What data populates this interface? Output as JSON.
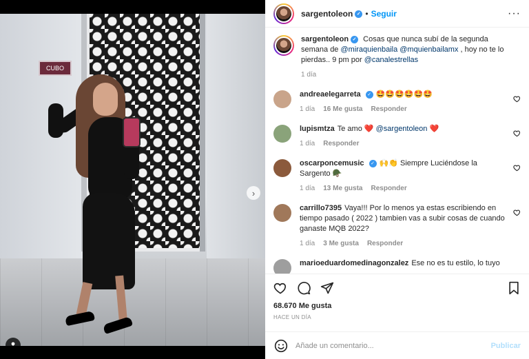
{
  "post": {
    "author": "sargentoleon",
    "follow_label": "Seguir",
    "caption_prefix": "Cosas que nunca subí de la segunda semana de ",
    "caption_mention1": "@miraquienbaila",
    "caption_mention2": "@mquienbailamx",
    "caption_middle": " , hoy no te lo pierdas.. 9 pm por ",
    "caption_mention3": "@canalestrellas",
    "caption_time": "1 día",
    "door_sign_text": "CUBO",
    "likes": "68.670 Me gusta",
    "date": "HACE UN DÍA",
    "carousel_dots": 5,
    "carousel_active_index": 0
  },
  "comments": [
    {
      "user": "andreaelegarreta",
      "verified": true,
      "text": "🤩🤩🤩🤩🤩🤩",
      "time": "1 día",
      "likes": "16 Me gusta",
      "reply": "Responder",
      "avatar_color": "#c9a48a"
    },
    {
      "user": "lupismtza",
      "verified": false,
      "text": "Te amo ❤️ ",
      "mention": "@sargentoleon",
      "text_after": " ❤️",
      "time": "1 día",
      "likes": "",
      "reply": "Responder",
      "avatar_color": "#8aa37a"
    },
    {
      "user": "oscarponcemusic",
      "verified": true,
      "text": "🙌👏 Siempre Luciéndose la Sargento 🪖",
      "time": "1 día",
      "likes": "13 Me gusta",
      "reply": "Responder",
      "avatar_color": "#8b5a3c"
    },
    {
      "user": "carrillo7395",
      "verified": false,
      "text": "Vaya!!! Por lo menos ya estas escribiendo en tiempo pasado ( 2022 ) tambien vas a subir cosas de cuando ganaste MQB 2022?",
      "time": "1 día",
      "likes": "3 Me gusta",
      "reply": "Responder",
      "avatar_color": "#a0785a"
    },
    {
      "user": "marioeduardomedinagonzalez",
      "verified": false,
      "text": "Ese no es tu estilo, lo tuyo",
      "time": "",
      "likes": "",
      "reply": "",
      "avatar_color": "#9e9e9e"
    }
  ],
  "add_comment": {
    "placeholder": "Añade un comentario...",
    "publish_label": "Publicar"
  },
  "icons": {
    "verified": "verified-badge-icon",
    "like": "heart-icon",
    "comment": "comment-icon",
    "share": "paper-plane-icon",
    "save": "bookmark-icon",
    "emoji": "smiley-icon",
    "more": "more-options-icon",
    "next": "chevron-right-icon",
    "tag": "user-tag-icon"
  },
  "colors": {
    "accent": "#0095f6",
    "text": "#262626",
    "muted": "#8e8e8e",
    "publish_disabled": "#b2dffc"
  }
}
